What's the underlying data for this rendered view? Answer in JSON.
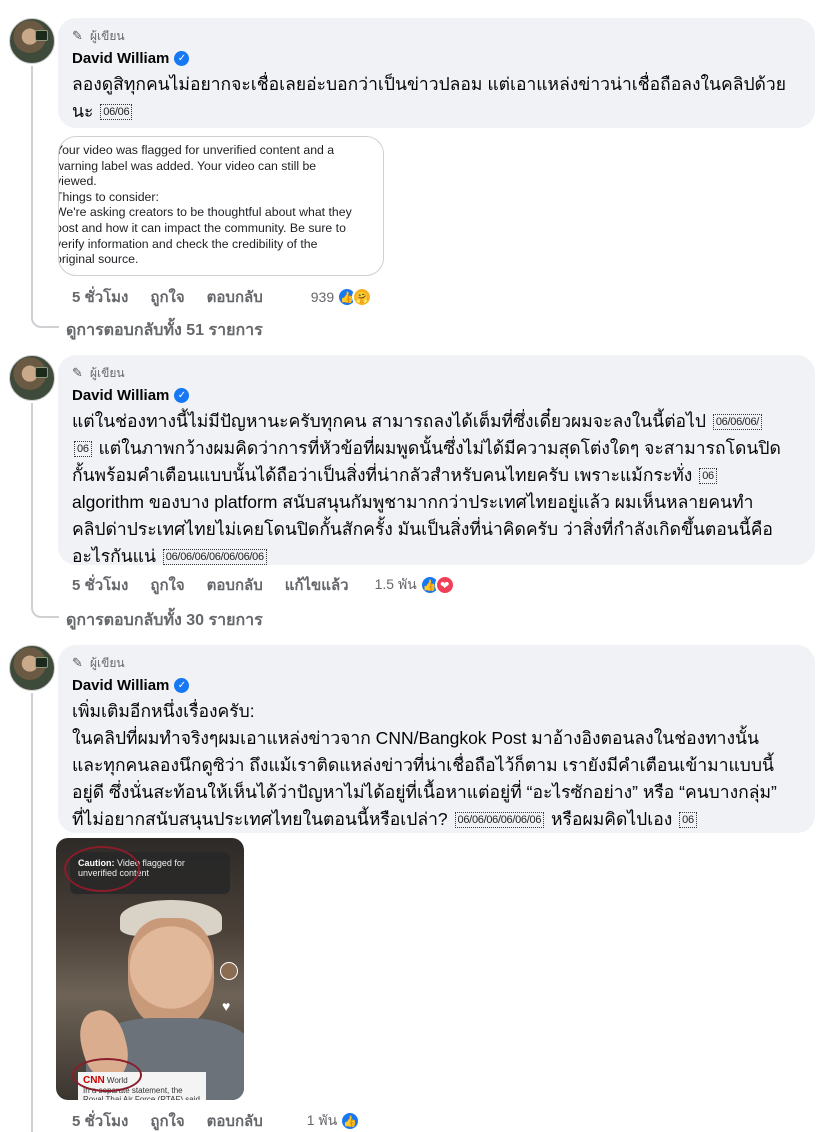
{
  "comments": [
    {
      "badge": "ผู้เขียน",
      "author": "David William",
      "text_lines": [
        "ลองดูสิทุกคนไม่อยากจะเชื่อเลยอ่ะบอกว่าเป็นข่าวปลอม แต่เอาแหล่งข่าวน่าเชื่อถือลงในคลิปด้วย",
        "นะ"
      ],
      "emoji_codes": [
        "06/06"
      ],
      "attachment_lines": [
        "Your video was flagged for unverified content and a",
        "warning label was added. Your video can still be",
        "viewed.",
        "Things to consider:",
        "We're asking creators to be thoughtful about what they",
        "post and how it can impact the community. Be sure to",
        "verify information and check the credibility of the",
        "original source."
      ],
      "time": "5 ชั่วโมง",
      "like_label": "ถูกใจ",
      "reply_label": "ตอบกลับ",
      "reaction_count": "939",
      "view_replies": "ดูการตอบกลับทั้ง 51 รายการ"
    },
    {
      "badge": "ผู้เขียน",
      "author": "David William",
      "line1": "แต่ในช่องทางนี้ไม่มีปัญหานะครับทุกคน สามารถลงได้เต็มที่ซึ่งเดี๋ยวผมจะลงในนี้ต่อไป",
      "line1_code": "06/06/06/",
      "line2_code": "06",
      "line2": "แต่ในภาพกว้างผมคิดว่าการที่หัวข้อที่ผมพูดนั้นซึ่งไม่ได้มีความสุดโต่งใดๆ จะสามารถโดนปิด",
      "line3": "กั้นพร้อมคำเตือนแบบนั้นได้ถือว่าเป็นสิ่งที่น่ากลัวสำหรับคนไทยครับ เพราะแม้กระทั่ง",
      "line3_code": "06",
      "line4": "algorithm ของบาง platform สนับสนุนกัมพูชามากกว่าประเทศไทยอยู่แล้ว ผมเห็นหลายคนทำ",
      "line5": "คลิปด่าประเทศไทยไม่เคยโดนปิดกั้นสักครั้ง มันเป็นสิ่งที่น่าคิดครับ ว่าสิ่งที่กำลังเกิดขึ้นตอนนี้คือ",
      "line6": "อะไรกันแน่",
      "line6_code": "06/06/06/06/06/06/06",
      "time": "5 ชั่วโมง",
      "like_label": "ถูกใจ",
      "reply_label": "ตอบกลับ",
      "edited_label": "แก้ไขแล้ว",
      "reaction_count": "1.5 พัน",
      "view_replies": "ดูการตอบกลับทั้ง 30 รายการ"
    },
    {
      "badge": "ผู้เขียน",
      "author": "David William",
      "line1": "เพิ่มเติมอีกหนึ่งเรื่องครับ:",
      "line2": "ในคลิปที่ผมทำจริงๆผมเอาแหล่งข่าวจาก CNN/Bangkok Post มาอ้างอิงตอนลงในช่องทางนั้น",
      "line3": "และทุกคนลองนึกดูซิว่า ถึงแม้เราติดแหล่งข่าวที่น่าเชื่อถือไว้ก็ตาม เรายังมีคำเตือนเข้ามาแบบนี้",
      "line4": "อยู่ดี ซึ่งนั่นสะท้อนให้เห็นได้ว่าปัญหาไม่ได้อยู่ที่เนื้อหาแต่อยู่ที่ “อะไรซักอย่าง” หรือ “คนบางกลุ่ม”",
      "line5": "ที่ไม่อยากสนับสนุนประเทศไทยในตอนนี้หรือเปล่า?",
      "line5_code": "06/06/06/06/06/06",
      "line5_tail": "หรือผมคิดไปเอง",
      "line5_code2": "06",
      "thumb_warning_title": "Caution:",
      "thumb_warning_text": "Video flagged for unverified content",
      "thumb_news_brand": "CNN",
      "thumb_news_brand2": "World",
      "thumb_news_text": "In a separate statement, the Royal Thai Air Force (RTAF) said \"Cambodia had",
      "time": "5 ชั่วโมง",
      "like_label": "ถูกใจ",
      "reply_label": "ตอบกลับ",
      "reaction_count": "1 พัน"
    }
  ],
  "icons": {
    "pen": "✎",
    "verified": "✓",
    "like": "👍",
    "care": "🤗",
    "love": "❤"
  },
  "colors": {
    "bubble_bg": "#f0f2f5",
    "meta_text": "#65676b",
    "like_blue": "#1877f2",
    "love_red": "#f33e58",
    "care_yellow": "#f7b125"
  }
}
